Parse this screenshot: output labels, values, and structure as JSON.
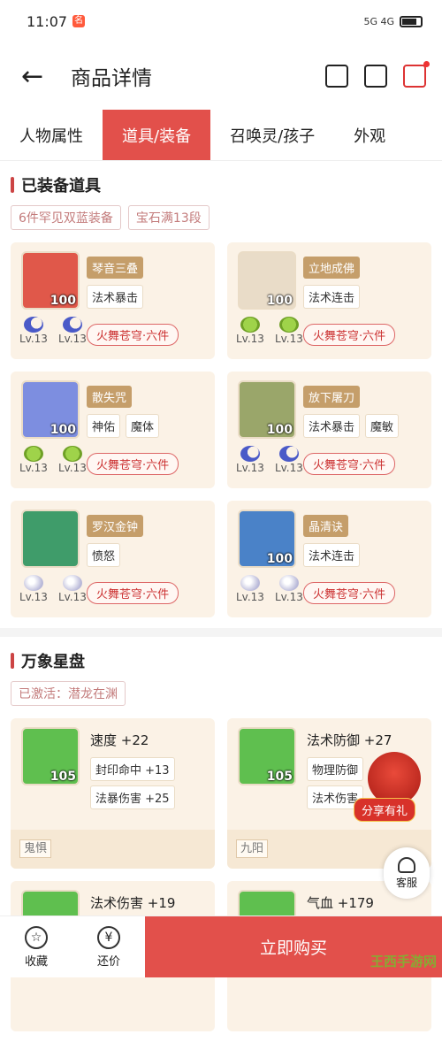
{
  "status": {
    "time": "11:07",
    "badge": "名",
    "signal": "5G 4G"
  },
  "header": {
    "title": "商品详情"
  },
  "tabs": [
    "人物属性",
    "道具/装备",
    "召唤灵/孩子",
    "外观"
  ],
  "equip": {
    "title": "已装备道具",
    "tags": [
      "6件罕见双蓝装备",
      "宝石满13段"
    ],
    "items": [
      {
        "name": "琴音三叠",
        "attrs": [
          "法术暴击"
        ],
        "gems": [
          "moon",
          "moon"
        ],
        "level": "100",
        "set": "火舞苍穹·六件",
        "lvs": [
          "Lv.13",
          "Lv.13"
        ],
        "color": "#e0584a"
      },
      {
        "name": "立地成佛",
        "attrs": [
          "法术连击"
        ],
        "gems": [
          "leaf",
          "leaf"
        ],
        "level": "100",
        "set": "火舞苍穹·六件",
        "lvs": [
          "Lv.13",
          "Lv.13"
        ],
        "color": "#e9dcc8"
      },
      {
        "name": "散失咒",
        "attrs": [
          "神佑",
          "魔体"
        ],
        "gems": [
          "leaf",
          "leaf"
        ],
        "level": "100",
        "set": "火舞苍穹·六件",
        "lvs": [
          "Lv.13",
          "Lv.13"
        ],
        "color": "#7d8ee0"
      },
      {
        "name": "放下屠刀",
        "attrs": [
          "法术暴击",
          "魔敏"
        ],
        "gems": [
          "moon",
          "moon"
        ],
        "level": "100",
        "set": "火舞苍穹·六件",
        "lvs": [
          "Lv.13",
          "Lv.13"
        ],
        "color": "#9aa66a"
      },
      {
        "name": "罗汉金钟",
        "attrs": [
          "愤怒"
        ],
        "gems": [
          "pearl",
          "pearl"
        ],
        "level": "",
        "set": "火舞苍穹·六件",
        "lvs": [
          "Lv.13",
          "Lv.13"
        ],
        "color": "#3f9c6a"
      },
      {
        "name": "晶清诀",
        "attrs": [
          "法术连击"
        ],
        "gems": [
          "pearl",
          "pearl"
        ],
        "level": "100",
        "set": "火舞苍穹·六件",
        "lvs": [
          "Lv.13",
          "Lv.13"
        ],
        "color": "#4a82c8"
      }
    ]
  },
  "stars": {
    "title": "万象星盘",
    "tag": "已激活：潜龙在渊",
    "items": [
      {
        "stat": "速度 +22",
        "sub1": "封印命中 +13",
        "sub2": "法暴伤害 +25",
        "level": "105",
        "foot": "鬼惧"
      },
      {
        "stat": "法术防御 +27",
        "sub1": "物理防御",
        "sub2": "法术伤害",
        "level": "105",
        "foot": "九阳"
      },
      {
        "stat": "法术伤害 +19",
        "sub1": "",
        "sub2": "",
        "level": "",
        "foot": ""
      },
      {
        "stat": "气血 +179",
        "sub1": "",
        "sub2": "",
        "level": "",
        "foot": ""
      }
    ]
  },
  "float": {
    "share": "分享有礼",
    "service": "客服"
  },
  "bottom": {
    "fav": "收藏",
    "bargain": "还价",
    "buy": "立即购买",
    "yen": "¥"
  },
  "watermark": "王西手游网"
}
